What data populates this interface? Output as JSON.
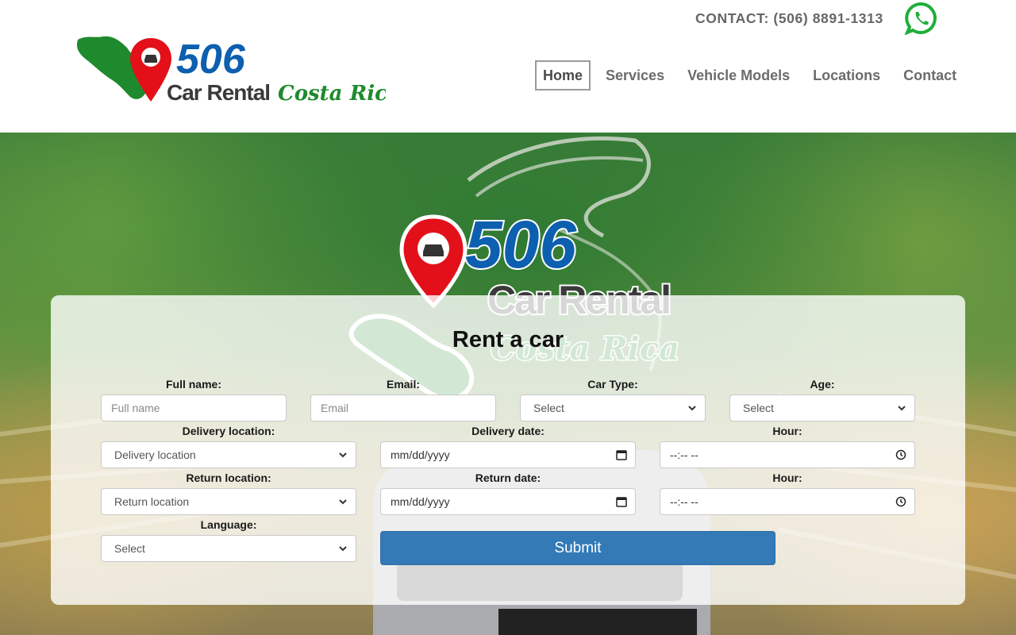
{
  "brand": {
    "logo_number": "506",
    "logo_text": "Car Rental",
    "logo_script": "Costa Rica"
  },
  "header": {
    "contact_text": "CONTACT: (506) 8891-1313",
    "whatsapp_icon": "whatsapp-icon"
  },
  "nav": {
    "items": [
      {
        "label": "Home",
        "active": true
      },
      {
        "label": "Services",
        "active": false
      },
      {
        "label": "Vehicle Models",
        "active": false
      },
      {
        "label": "Locations",
        "active": false
      },
      {
        "label": "Contact",
        "active": false
      }
    ]
  },
  "form": {
    "title": "Rent a car",
    "full_name": {
      "label": "Full name:",
      "placeholder": "Full name"
    },
    "email": {
      "label": "Email:",
      "placeholder": "Email"
    },
    "car_type": {
      "label": "Car Type:",
      "value": "Select"
    },
    "age": {
      "label": "Age:",
      "value": "Select"
    },
    "delivery_location": {
      "label": "Delivery location:",
      "value": "Delivery location"
    },
    "delivery_date": {
      "label": "Delivery date:",
      "placeholder": "mm/dd/yyyy"
    },
    "delivery_hour": {
      "label": "Hour:",
      "placeholder": "--:-- --"
    },
    "return_location": {
      "label": "Return location:",
      "value": "Return location"
    },
    "return_date": {
      "label": "Return date:",
      "placeholder": "mm/dd/yyyy"
    },
    "return_hour": {
      "label": "Hour:",
      "placeholder": "--:-- --"
    },
    "language": {
      "label": "Language:",
      "value": "Select"
    },
    "submit_label": "Submit"
  },
  "colors": {
    "brand_blue": "#0d5fb0",
    "brand_green": "#1f8a2d",
    "pin_red": "#e3101a",
    "submit_blue": "#337ab7",
    "nav_text": "#6b6b6b",
    "whatsapp_green": "#1fae3b"
  }
}
